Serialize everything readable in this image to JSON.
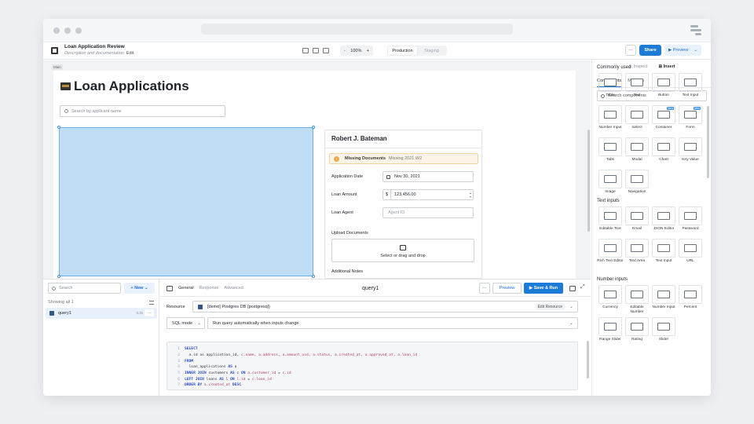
{
  "app": {
    "title": "Loan Application Review",
    "description": "Description and documentation",
    "edit_link": "Edit",
    "zoom": "100%",
    "zoom_minus": "-",
    "zoom_plus": "+",
    "env_production": "Production",
    "env_staging": "Staging",
    "more": "···",
    "share": "Share",
    "preview": "Preview"
  },
  "canvas": {
    "container_tag": "Main",
    "heading": "Loan Applications",
    "search_placeholder": "Search by applicant name"
  },
  "form": {
    "applicant": "Robert J. Bateman",
    "alert_title": "Missing Documents",
    "alert_message": "Missing 2021 W2",
    "alert_icon": "!",
    "date_label": "Application Date",
    "date_value": "Nov 30, 2021",
    "amount_label": "Loan Amount",
    "amount_prefix": "$",
    "amount_value": "123,456.00",
    "agent_label": "Loan Agent",
    "agent_placeholder": "Agent ID",
    "upload_label": "Upload Documents",
    "upload_text": "Select or drag and drop",
    "notes_label": "Additional Notes"
  },
  "queries": {
    "search_placeholder": "Search",
    "new_label": "+ New ⌄",
    "count": "Showing all 1",
    "items": [
      {
        "name": "query1",
        "time": "0.3s",
        "more": "···"
      }
    ]
  },
  "editor": {
    "tabs": [
      "General",
      "Response",
      "Advanced"
    ],
    "query_name": "query1",
    "preview": "Preview",
    "save_run": "▶ Save & Run",
    "more": "···",
    "resource_label": "Resource",
    "resource_value": "[demo] Postgres DB (postgresql)",
    "edit_resource": "Edit Resource",
    "mode": "SQL mode",
    "run_mode": "Run query automatically when inputs change",
    "code_lines": [
      {
        "n": "1",
        "parts": [
          {
            "t": "SELECT",
            "c": "kw"
          }
        ]
      },
      {
        "n": "2",
        "parts": [
          {
            "t": "  a.id as application_id, ",
            "c": "tx"
          },
          {
            "t": "c.name",
            "c": "col"
          },
          {
            "t": ", ",
            "c": "tx"
          },
          {
            "t": "a.address",
            "c": "col"
          },
          {
            "t": ", ",
            "c": "tx"
          },
          {
            "t": "a.amount_usd",
            "c": "col"
          },
          {
            "t": ", ",
            "c": "tx"
          },
          {
            "t": "a.status",
            "c": "col"
          },
          {
            "t": ", ",
            "c": "tx"
          },
          {
            "t": "a.created_at",
            "c": "col"
          },
          {
            "t": ", ",
            "c": "tx"
          },
          {
            "t": "a.approved_at",
            "c": "col"
          },
          {
            "t": ", ",
            "c": "tx"
          },
          {
            "t": "a.loan_id",
            "c": "col"
          }
        ]
      },
      {
        "n": "3",
        "parts": [
          {
            "t": "FROM",
            "c": "kw"
          }
        ]
      },
      {
        "n": "4",
        "parts": [
          {
            "t": "  loan_applications ",
            "c": "tx"
          },
          {
            "t": "AS",
            "c": "kw"
          },
          {
            "t": " a",
            "c": "tx"
          }
        ]
      },
      {
        "n": "5",
        "parts": [
          {
            "t": "INNER JOIN",
            "c": "kw"
          },
          {
            "t": " customers ",
            "c": "tx"
          },
          {
            "t": "AS",
            "c": "kw"
          },
          {
            "t": " c ",
            "c": "tx"
          },
          {
            "t": "ON",
            "c": "kw"
          },
          {
            "t": " ",
            "c": "tx"
          },
          {
            "t": "a.customer_id",
            "c": "col"
          },
          {
            "t": " = ",
            "c": "tx"
          },
          {
            "t": "c.id",
            "c": "col"
          }
        ]
      },
      {
        "n": "6",
        "parts": [
          {
            "t": "LEFT JOIN",
            "c": "kw"
          },
          {
            "t": " loans ",
            "c": "tx"
          },
          {
            "t": "AS",
            "c": "kw"
          },
          {
            "t": " l ",
            "c": "tx"
          },
          {
            "t": "ON",
            "c": "kw"
          },
          {
            "t": " ",
            "c": "tx"
          },
          {
            "t": "l.id",
            "c": "col"
          },
          {
            "t": " = ",
            "c": "tx"
          },
          {
            "t": "c.loan_id",
            "c": "col"
          }
        ]
      },
      {
        "n": "7",
        "parts": [
          {
            "t": "ORDER BY",
            "c": "kw"
          },
          {
            "t": " ",
            "c": "tx"
          },
          {
            "t": "a.created_at",
            "c": "col"
          },
          {
            "t": " ",
            "c": "tx"
          },
          {
            "t": "DESC",
            "c": "kw"
          }
        ]
      }
    ]
  },
  "panel": {
    "tab_inspect": "Inspect",
    "tab_insert": "Insert",
    "subtab_components": "Components",
    "subtab_modules": "Modules",
    "search_placeholder": "Search components",
    "sections": [
      {
        "title": "Commonly used",
        "items": [
          {
            "label": "Table",
            "icon": "table-icon"
          },
          {
            "label": "Text",
            "icon": "text-icon"
          },
          {
            "label": "Button",
            "icon": "button-icon"
          },
          {
            "label": "Text Input",
            "icon": "text-input-icon"
          },
          {
            "label": "Number Input",
            "icon": "number-input-icon"
          },
          {
            "label": "Select",
            "icon": "select-icon"
          },
          {
            "label": "Container",
            "icon": "container-icon",
            "badge": "New"
          },
          {
            "label": "Form",
            "icon": "form-icon",
            "badge": "New"
          },
          {
            "label": "Tabs",
            "icon": "tabs-icon"
          },
          {
            "label": "Modal",
            "icon": "modal-icon"
          },
          {
            "label": "Chart",
            "icon": "chart-icon"
          },
          {
            "label": "Key Value",
            "icon": "key-value-icon"
          },
          {
            "label": "Image",
            "icon": "image-icon"
          },
          {
            "label": "Navigation",
            "icon": "navigation-icon"
          }
        ]
      },
      {
        "title": "Text inputs",
        "items": [
          {
            "label": "Editable Text",
            "icon": "editable-text-icon"
          },
          {
            "label": "Email",
            "icon": "email-icon"
          },
          {
            "label": "JSON Editor",
            "icon": "json-editor-icon"
          },
          {
            "label": "Password",
            "icon": "password-icon"
          },
          {
            "label": "Rich Text Editor",
            "icon": "rich-text-editor-icon"
          },
          {
            "label": "Text Area",
            "icon": "text-area-icon"
          },
          {
            "label": "Text Input",
            "icon": "text-input-icon"
          },
          {
            "label": "URL",
            "icon": "url-icon"
          }
        ]
      },
      {
        "title": "Number inputs",
        "items": [
          {
            "label": "Currency",
            "icon": "currency-icon"
          },
          {
            "label": "Editable Number",
            "icon": "editable-number-icon"
          },
          {
            "label": "Number Input",
            "icon": "number-input-icon"
          },
          {
            "label": "Percent",
            "icon": "percent-icon"
          },
          {
            "label": "Range Slider",
            "icon": "range-slider-icon"
          },
          {
            "label": "Rating",
            "icon": "rating-icon"
          },
          {
            "label": "Slider",
            "icon": "slider-icon"
          }
        ]
      }
    ]
  },
  "colors": {
    "accent": "#1c7bd6",
    "image_fill": "#bfddf4",
    "alert_bg": "#fdf4e7"
  }
}
